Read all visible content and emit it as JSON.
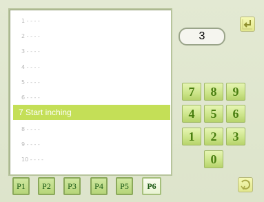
{
  "list": {
    "items": [
      {
        "label": "1 - - - -"
      },
      {
        "label": "2 - - - -"
      },
      {
        "label": "3 - - - -"
      },
      {
        "label": "4 - - - -"
      },
      {
        "label": "5 - - - -"
      },
      {
        "label": "6 - - - -"
      },
      {
        "label": "7 Start inching"
      },
      {
        "label": "8 - - - -"
      },
      {
        "label": "9 - - - -"
      },
      {
        "label": "10 - - - -"
      }
    ],
    "selected_index": 6
  },
  "display": {
    "value": "3"
  },
  "keypad": {
    "keys": [
      "7",
      "8",
      "9",
      "4",
      "5",
      "6",
      "1",
      "2",
      "3",
      "0"
    ]
  },
  "tabs": {
    "labels": [
      "P1",
      "P2",
      "P3",
      "P4",
      "P5",
      "P6"
    ],
    "active": "P6"
  },
  "colors": {
    "accent": "#c4df57",
    "key_text": "#4a7f11"
  },
  "icons": {
    "top_right": "enter-icon",
    "bottom_right": "return-icon"
  }
}
